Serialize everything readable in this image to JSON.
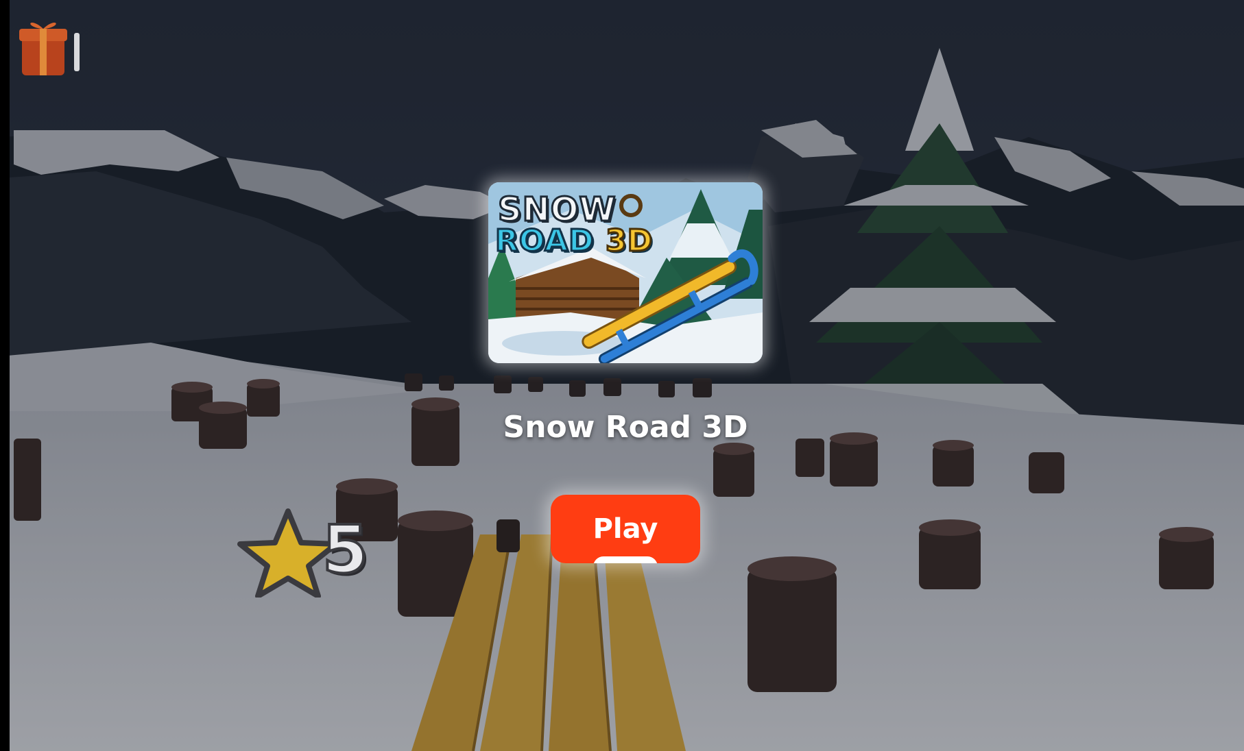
{
  "game": {
    "title": "Snow Road 3D",
    "thumbnail": {
      "word_snow": "SNOW",
      "word_road": "ROAD",
      "word_3d": "3D"
    }
  },
  "play_button": {
    "label": "Play"
  },
  "hud": {
    "score": "5",
    "score_icon": "star-icon",
    "gift_icon": "gift-icon"
  },
  "colors": {
    "play_button": "#ff3d12",
    "title_text": "#ffffff",
    "snow": "#c9ccd2",
    "sky": "#2b3442",
    "planks": "#c99a37",
    "star": "#d8b02a"
  }
}
